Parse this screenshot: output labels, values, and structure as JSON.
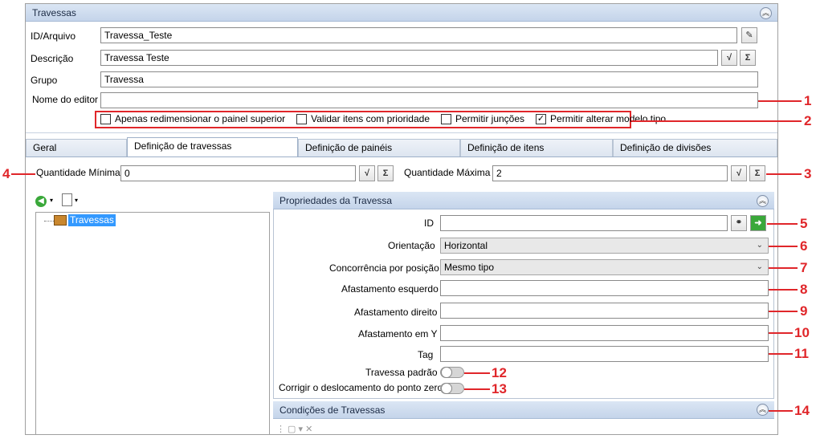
{
  "header": {
    "title": "Travessas"
  },
  "top_form": {
    "id_label": "ID/Arquivo",
    "id_value": "Travessa_Teste",
    "desc_label": "Descrição",
    "desc_value": "Travessa Teste",
    "group_label": "Grupo",
    "group_value": "Travessa",
    "editor_label": "Nome do editor",
    "editor_value": ""
  },
  "checkboxes": [
    {
      "label": "Apenas redimensionar o painel superior",
      "checked": false
    },
    {
      "label": "Validar itens com prioridade",
      "checked": false
    },
    {
      "label": "Permitir junções",
      "checked": false
    },
    {
      "label": "Permitir alterar modelo tipo",
      "checked": true
    }
  ],
  "tabs": [
    "Geral",
    "Definição de travessas",
    "Definição de painéis",
    "Definição de itens",
    "Definição de divisões"
  ],
  "active_tab": 1,
  "quantities": {
    "min_label": "Quantidade Mínima",
    "min_value": "0",
    "max_label": "Quantidade Máxima",
    "max_value": "2"
  },
  "tree": {
    "root_label": "Travessas"
  },
  "properties": {
    "title": "Propriedades da Travessa",
    "id_label": "ID",
    "id_value": "",
    "orientation_label": "Orientação",
    "orientation_value": "Horizontal",
    "concurrency_label": "Concorrência por posição",
    "concurrency_value": "Mesmo tipo",
    "left_gap_label": "Afastamento esquerdo",
    "left_gap_value": "",
    "right_gap_label": "Afastamento direito",
    "right_gap_value": "",
    "y_gap_label": "Afastamento em Y",
    "y_gap_value": "",
    "tag_label": "Tag",
    "tag_value": "",
    "default_label": "Travessa padrão",
    "default_on": false,
    "zero_label": "Corrigir o deslocamento do ponto zero",
    "zero_on": false
  },
  "conditions": {
    "title": "Condições de Travessas"
  },
  "callouts": [
    "1",
    "2",
    "3",
    "4",
    "5",
    "6",
    "7",
    "8",
    "9",
    "10",
    "11",
    "12",
    "13",
    "14"
  ],
  "colors": {
    "callout": "#e0262a",
    "header_bg": "#c4d4ea",
    "selection": "#3399ff"
  },
  "icons": {
    "formula": "sqrt-formula-icon",
    "sum": "sigma-icon",
    "browse": "binoculars-icon",
    "go": "arrow-right-icon",
    "back": "back-arrow-icon",
    "new": "new-item-icon",
    "collapse": "double-chevron-up-icon"
  }
}
